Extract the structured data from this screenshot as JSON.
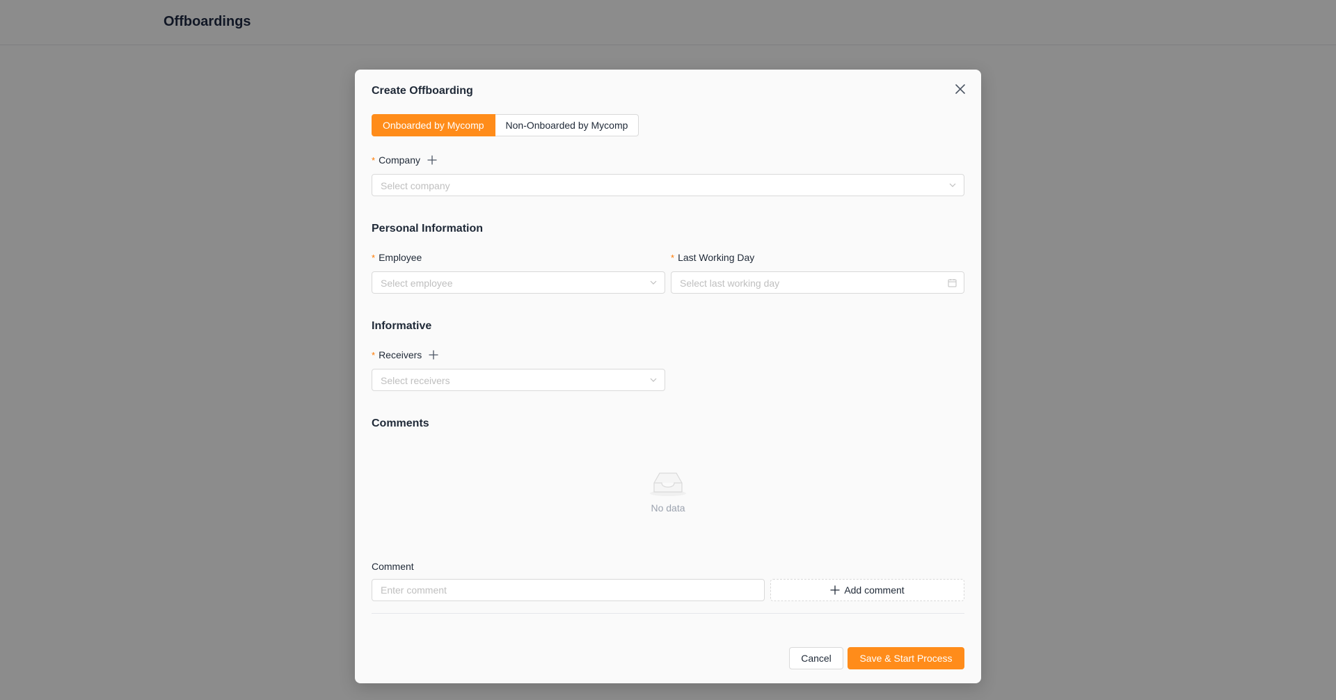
{
  "page": {
    "title": "Offboardings"
  },
  "modal": {
    "title": "Create Offboarding",
    "tabs": [
      {
        "label": "Onboarded by Mycomp",
        "active": true
      },
      {
        "label": "Non-Onboarded by Mycomp",
        "active": false
      }
    ],
    "company": {
      "required_mark": "*",
      "label": "Company",
      "placeholder": "Select company"
    },
    "personal_information": {
      "title": "Personal Information",
      "employee": {
        "required_mark": "*",
        "label": "Employee",
        "placeholder": "Select employee"
      },
      "last_working_day": {
        "required_mark": "*",
        "label": "Last Working Day",
        "placeholder": "Select last working day"
      }
    },
    "informative": {
      "title": "Informative",
      "receivers": {
        "required_mark": "*",
        "label": "Receivers",
        "placeholder": "Select receivers"
      }
    },
    "comments": {
      "title": "Comments",
      "empty_text": "No data",
      "comment_label": "Comment",
      "comment_placeholder": "Enter comment",
      "add_comment_label": "Add comment"
    },
    "footer": {
      "cancel_label": "Cancel",
      "submit_label": "Save & Start Process"
    }
  },
  "colors": {
    "primary": "#ff8c1a",
    "required": "#ff7a00",
    "title": "#1f2a44"
  },
  "icons": [
    "close-icon",
    "plus-icon",
    "chevron-down-icon",
    "calendar-icon",
    "empty-inbox-icon"
  ]
}
